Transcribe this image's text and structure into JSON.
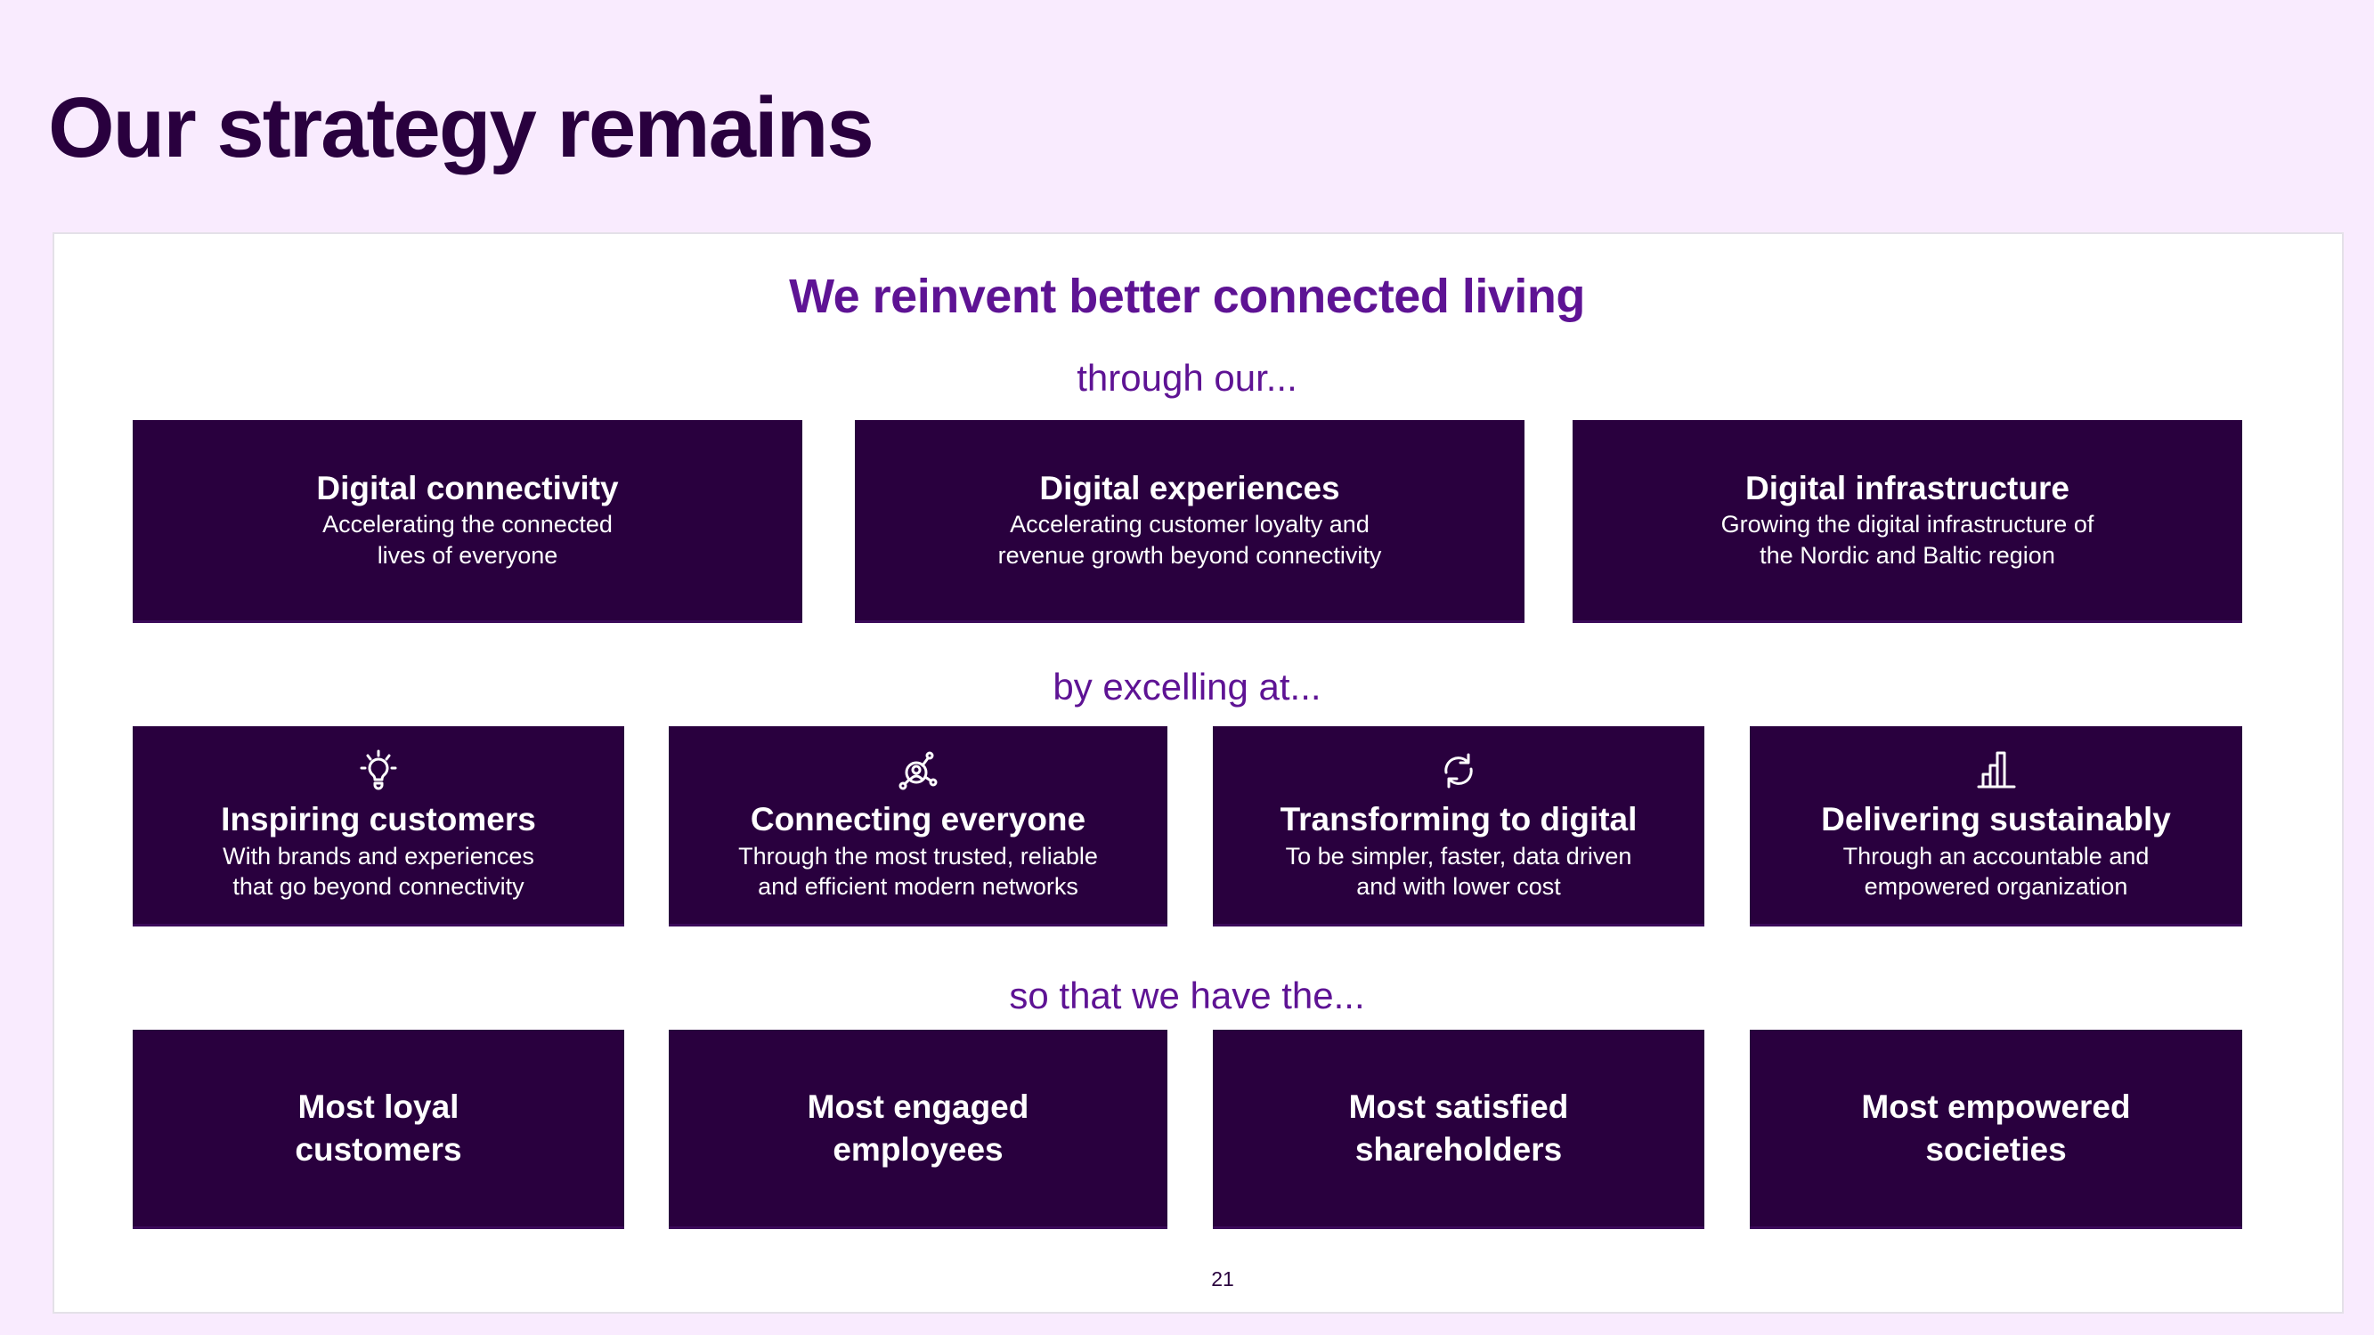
{
  "page": {
    "title": "Our strategy remains",
    "page_number": "21"
  },
  "colors": {
    "background": "#F9EBFE",
    "box_fill": "#29003E",
    "title_text": "#29003E",
    "accent_text": "#5E1394",
    "box_text": "#FFFFFF"
  },
  "strategy": {
    "mission": "We reinvent better connected living",
    "connectors": {
      "through": "through our...",
      "excelling": "by excelling at...",
      "outcomes": "so that we have the..."
    },
    "pillars": [
      {
        "title": "Digital connectivity",
        "description": "Accelerating the connected lives of everyone"
      },
      {
        "title": "Digital experiences",
        "description": "Accelerating customer loyalty and revenue growth beyond connectivity"
      },
      {
        "title": "Digital infrastructure",
        "description": "Growing the digital infrastructure of the Nordic and Baltic region"
      }
    ],
    "capabilities": [
      {
        "icon": "lightbulb-icon",
        "title": "Inspiring customers",
        "description": "With brands and experiences that go beyond connectivity"
      },
      {
        "icon": "network-user-icon",
        "title": "Connecting everyone",
        "description": "Through the most trusted, reliable and efficient modern networks"
      },
      {
        "icon": "refresh-icon",
        "title": "Transforming to digital",
        "description": "To be simpler, faster, data driven and with lower cost"
      },
      {
        "icon": "bar-chart-icon",
        "title": "Delivering sustainably",
        "description": "Through an accountable and empowered organization"
      }
    ],
    "outcomes": [
      {
        "label": "Most loyal customers"
      },
      {
        "label": "Most engaged employees"
      },
      {
        "label": "Most satisfied shareholders"
      },
      {
        "label": "Most empowered societies"
      }
    ]
  }
}
